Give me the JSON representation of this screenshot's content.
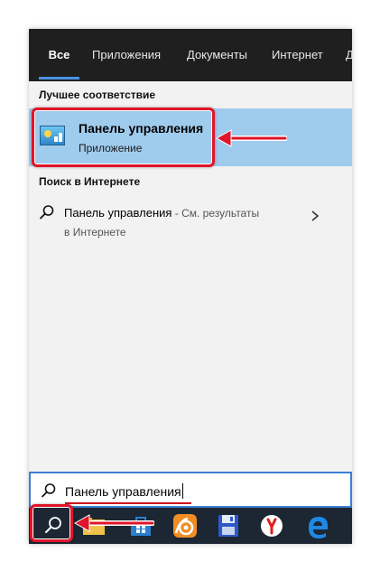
{
  "tabs": [
    {
      "label": "Все",
      "active": true
    },
    {
      "label": "Приложения",
      "active": false
    },
    {
      "label": "Документы",
      "active": false
    },
    {
      "label": "Интернет",
      "active": false
    },
    {
      "label": "Д",
      "active": false
    }
  ],
  "best_match": {
    "section_label": "Лучшее соответствие",
    "title": "Панель управления",
    "subtitle": "Приложение",
    "icon": "control-panel-icon"
  },
  "web_search": {
    "section_label": "Поиск в Интернете",
    "query": "Панель управления",
    "suffix": " - См. результаты",
    "line2": "в Интернете",
    "icon": "search-icon"
  },
  "search_box": {
    "value": "Панель управления",
    "icon": "search-icon"
  },
  "taskbar": {
    "apps": [
      "search-icon",
      "file-explorer-icon",
      "store-icon",
      "uc-browser-icon",
      "save-app-icon",
      "yandex-browser-icon",
      "edge-icon"
    ]
  },
  "colors": {
    "accent": "#4a90e2",
    "highlight": "#9fcbed",
    "annotation": "#e0142a",
    "tabbar": "#1f1f1f",
    "taskbar": "#1c2733"
  }
}
